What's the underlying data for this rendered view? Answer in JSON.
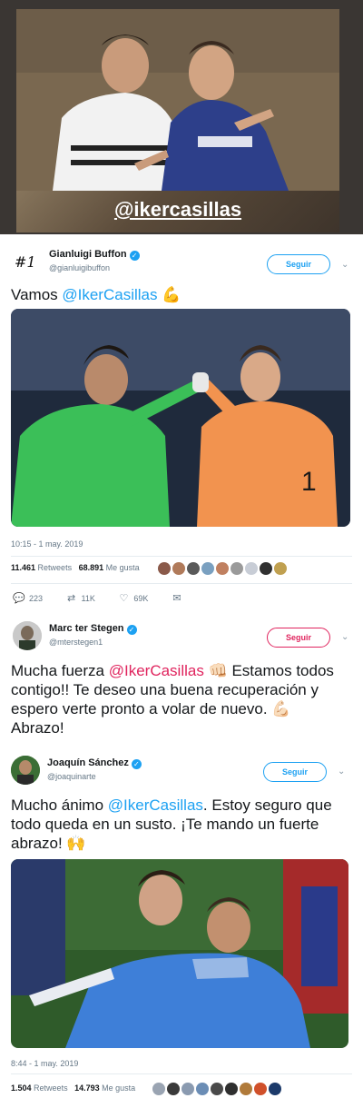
{
  "story": {
    "mention": "@ikercasillas"
  },
  "tweets": [
    {
      "name": "Gianluigi Buffon",
      "handle": "@gianluigibuffon",
      "follow": "Seguir",
      "text_prefix": "Vamos ",
      "mention": "@IkerCasillas",
      "text_suffix": " 💪",
      "time": "10:15 - 1 may. 2019",
      "retweets": "11.461",
      "retweets_label": "Retweets",
      "likes": "68.891",
      "likes_label": "Me gusta",
      "replies_count": "223",
      "retweet_count_short": "11K",
      "likes_count_short": "69K"
    },
    {
      "name": "Marc ter Stegen",
      "handle": "@mterstegen1",
      "follow": "Seguir",
      "text_prefix": "Mucha fuerza ",
      "mention": "@IkerCasillas",
      "text_suffix": " 👊🏻 Estamos todos contigo!! Te deseo una buena recuperación y espero verte pronto a volar de nuevo. 💪🏻 Abrazo!"
    },
    {
      "name": "Joaquín Sánchez",
      "handle": "@joaquinarte",
      "follow": "Seguir",
      "text_prefix": "Mucho ánimo ",
      "mention": "@IkerCasillas",
      "text_suffix": ".  Estoy seguro que todo queda en un susto. ¡Te mando un fuerte abrazo! 🙌",
      "time": "8:44 - 1 may. 2019",
      "retweets": "1.504",
      "retweets_label": "Retweets",
      "likes": "14.793",
      "likes_label": "Me gusta"
    }
  ],
  "icons": {
    "verified": "verified-badge-icon",
    "chevron": "chevron-down-icon",
    "reply": "reply-icon",
    "retweet": "retweet-icon",
    "like": "heart-icon",
    "message": "direct-message-icon"
  },
  "colors": {
    "twitter_blue": "#1da1f2",
    "follow_red": "#e0245e",
    "muted": "#657786"
  }
}
